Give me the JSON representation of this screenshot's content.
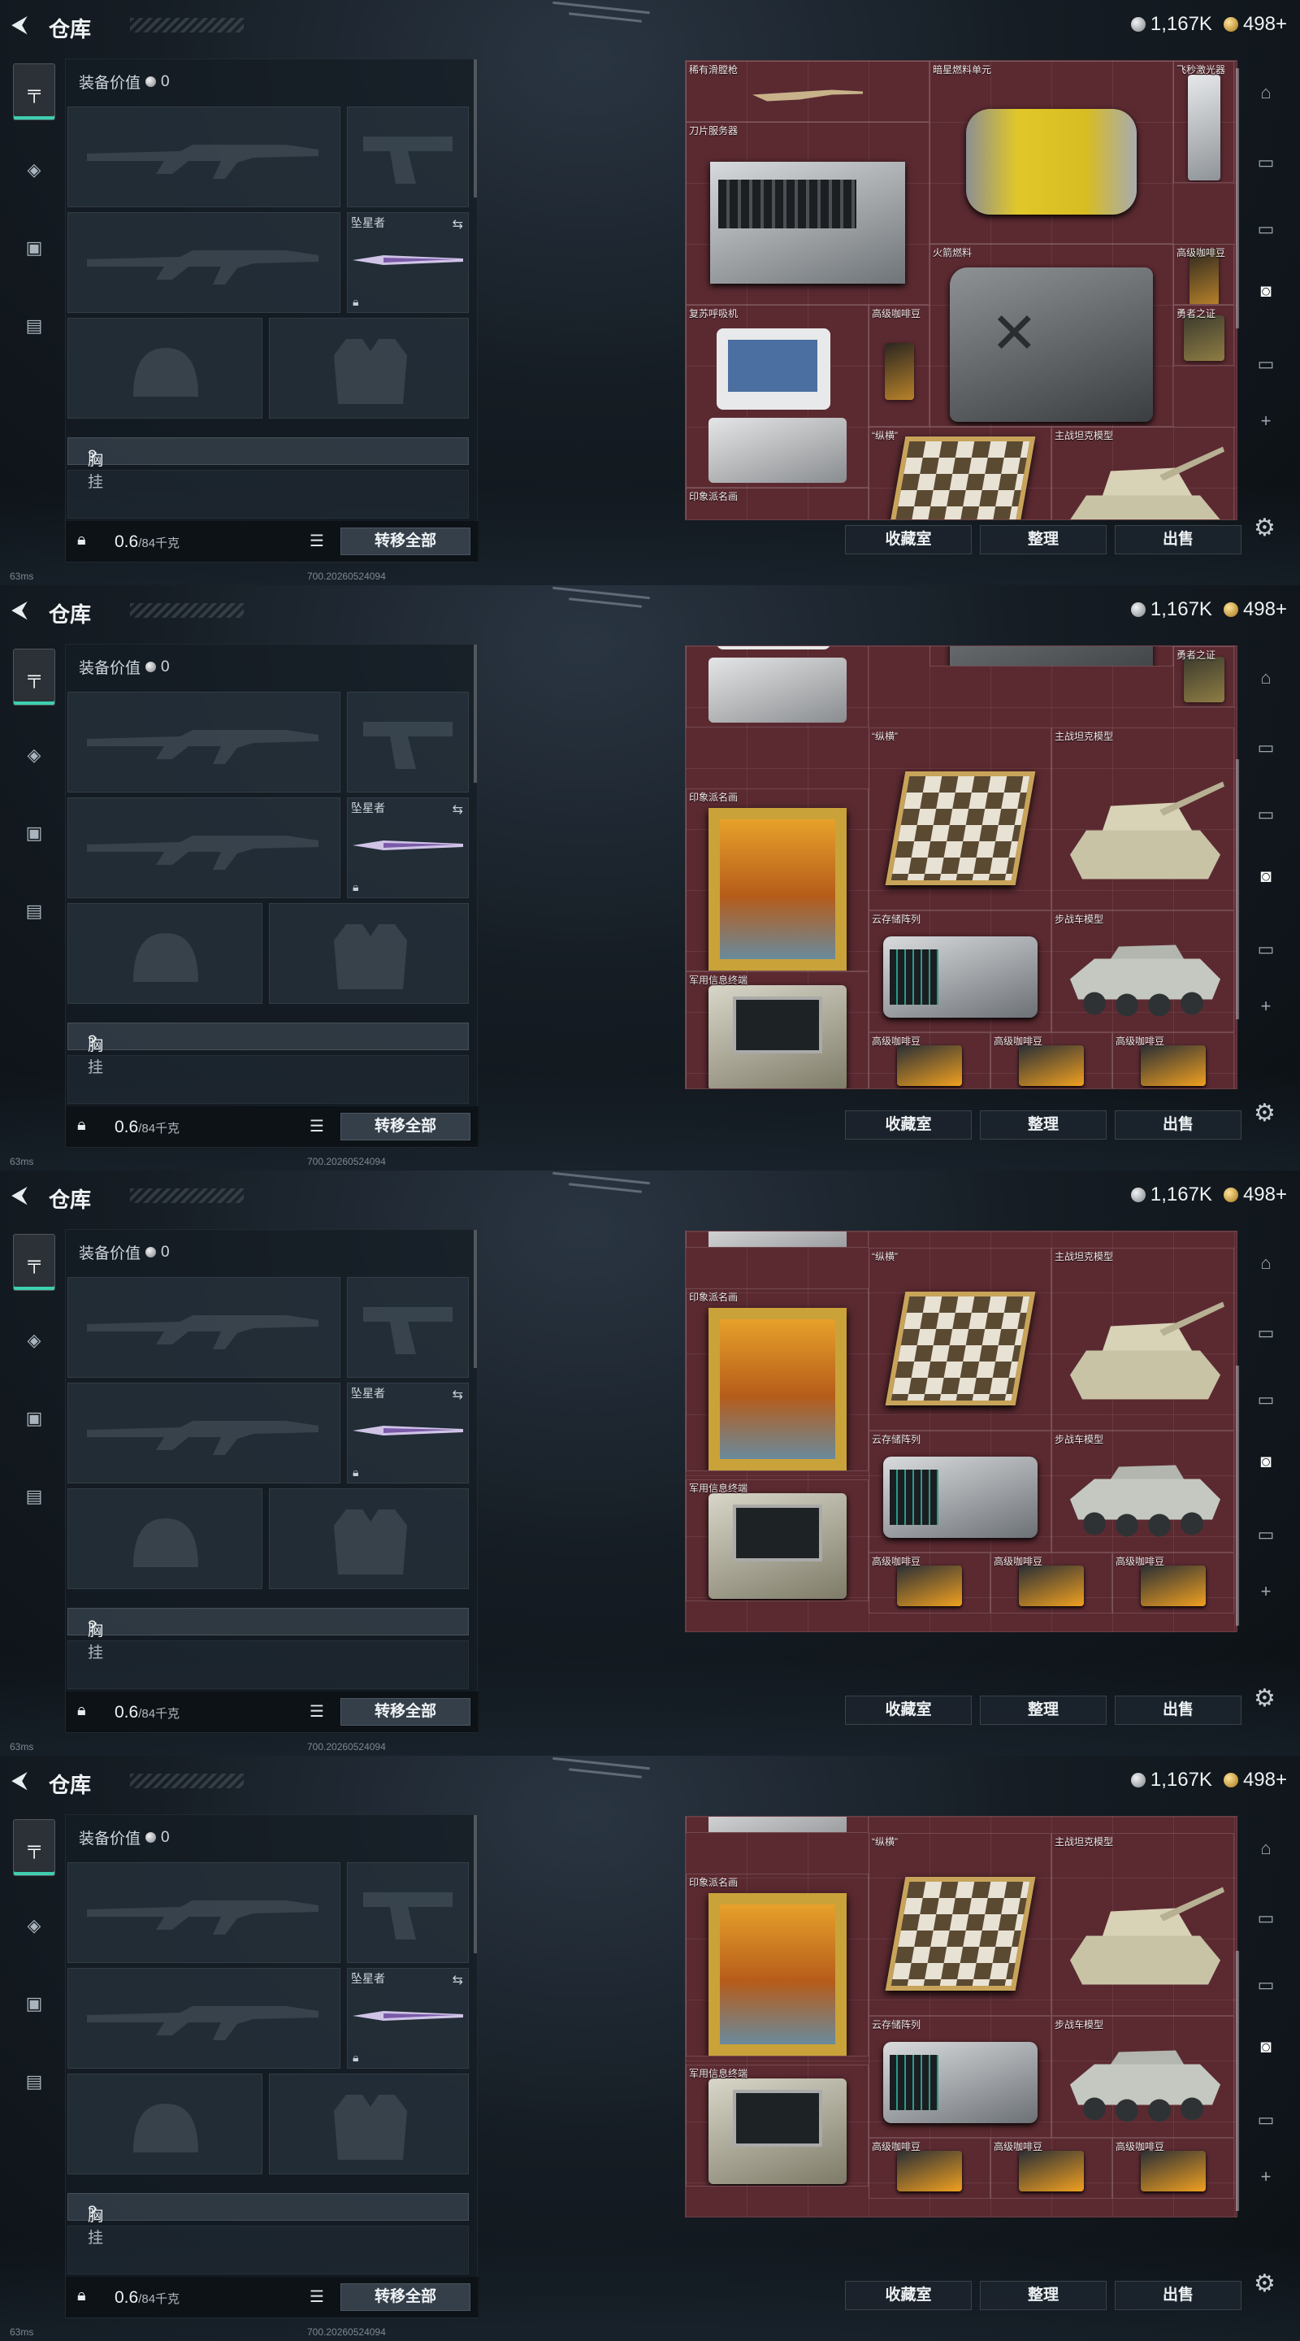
{
  "header": {
    "back_glyph": "⮜",
    "title": "仓库",
    "silver_amount": "1,167K",
    "gold_amount": "498+"
  },
  "loadout": {
    "equip_value_label": "装备价值",
    "equip_value": "0",
    "melee_label": "坠星者",
    "chest_rig_label": "胸挂",
    "chest_rig_hint": "?",
    "weight_value": "0.6",
    "weight_unit": "/84千克",
    "transfer_all_label": "转移全部",
    "ping": "63ms",
    "build": "700.20260524094"
  },
  "actions": {
    "collection_label": "收藏室",
    "sort_label": "整理",
    "sell_label": "出售"
  },
  "items": {
    "rare_sniper": "稀有滑膛枪",
    "dark_fuel": "暗星燃料单元",
    "flying_laser": "飞秒激光器",
    "blade_server": "刀片服务器",
    "rocket_fuel": "火箭燃料",
    "premium_coffee": "高级咖啡豆",
    "revive_breather": "复苏呼吸机",
    "hero_badge": "勇者之证",
    "chess_set": "“纵横”",
    "tank_model": "主战坦克模型",
    "impressionist_painting": "印象派名画",
    "cloud_storage": "云存储阵列",
    "ifv_model": "步战车模型",
    "military_terminal": "军用信息终端"
  },
  "colors": {
    "stash_bg": "#5b2a31",
    "accent_teal": "#3ed0b0"
  },
  "frames": [
    {
      "stash_state": "top"
    },
    {
      "stash_state": "scrolled-mid"
    },
    {
      "stash_state": "scrolled-bottom"
    },
    {
      "stash_state": "scrolled-bottom"
    }
  ]
}
